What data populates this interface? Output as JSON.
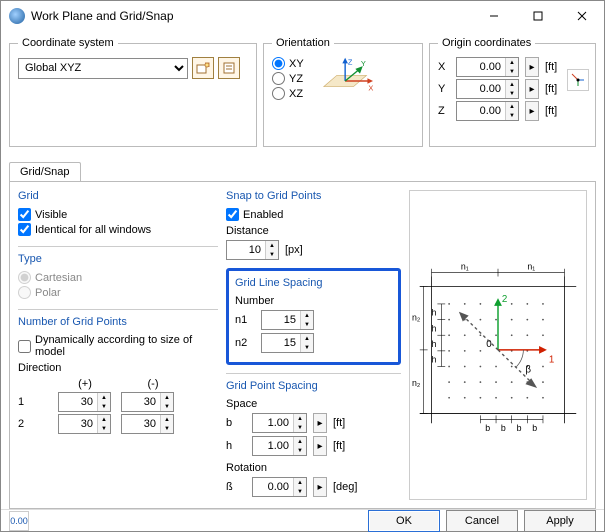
{
  "window": {
    "title": "Work Plane and Grid/Snap"
  },
  "coord": {
    "legend": "Coordinate system",
    "value": "Global XYZ"
  },
  "orient": {
    "legend": "Orientation",
    "options": {
      "xy": "XY",
      "yz": "YZ",
      "xz": "XZ"
    },
    "selected": "XY"
  },
  "origin": {
    "legend": "Origin coordinates",
    "labels": {
      "x": "X",
      "y": "Y",
      "z": "Z"
    },
    "x": "0.00",
    "y": "0.00",
    "z": "0.00",
    "unit": "[ft]"
  },
  "tab": {
    "label": "Grid/Snap"
  },
  "grid": {
    "title": "Grid",
    "visible_label": "Visible",
    "identical_label": "Identical for all windows",
    "visible": true,
    "identical": true
  },
  "type": {
    "title": "Type",
    "cartesian_label": "Cartesian",
    "polar_label": "Polar",
    "selected": "Cartesian"
  },
  "numpts": {
    "title": "Number of Grid Points",
    "dynamic_label": "Dynamically according to size of model",
    "dynamic": false,
    "direction_label": "Direction",
    "hdr_plus": "(+)",
    "hdr_minus": "(-)",
    "row1_idx": "1",
    "row1_plus": "30",
    "row1_minus": "30",
    "row2_idx": "2",
    "row2_plus": "30",
    "row2_minus": "30"
  },
  "snap": {
    "title": "Snap to Grid Points",
    "enabled_label": "Enabled",
    "enabled": true,
    "distance_label": "Distance",
    "distance": "10",
    "unit": "[px]"
  },
  "linespacing": {
    "title": "Grid Line Spacing",
    "number_label": "Number",
    "n1_label": "n1",
    "n1": "15",
    "n2_label": "n2",
    "n2": "15"
  },
  "ptspacing": {
    "title": "Grid Point Spacing",
    "space_label": "Space",
    "b_label": "b",
    "b": "1.00",
    "h_label": "h",
    "h": "1.00",
    "unit": "[ft]",
    "rotation_label": "Rotation",
    "beta_label": "ß",
    "beta": "0.00",
    "beta_unit": "[deg]"
  },
  "preview": {
    "n1": "n₁",
    "n1b": "n₁",
    "n2a": "n₂",
    "n2b": "n₂",
    "axis2": "2",
    "axis1": "1",
    "zero": "0",
    "b": "b",
    "h": "h",
    "beta": "β"
  },
  "footer": {
    "ok": "OK",
    "cancel": "Cancel",
    "apply": "Apply",
    "places_icon": "0.00"
  }
}
